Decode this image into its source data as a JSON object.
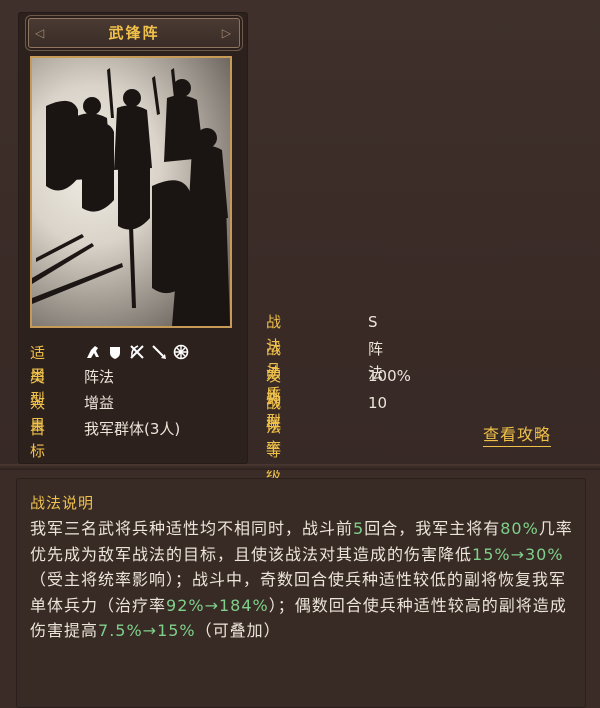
{
  "card": {
    "name": "武锋阵",
    "title_ornament_left": "◁",
    "title_ornament_right": "▷"
  },
  "properties": {
    "applicable_label": "适用",
    "troop_type_icons": [
      "cavalry-icon",
      "shield-icon",
      "bow-icon",
      "spear-icon",
      "siege-icon"
    ],
    "type_label": "类型",
    "type_value": "阵法",
    "effect_label": "效果",
    "effect_value": "增益",
    "target_label": "目标",
    "target_value": "我军群体(3人)"
  },
  "stats": [
    {
      "label": "战法品质",
      "value": "S"
    },
    {
      "label": "战法类型",
      "value": "阵法"
    },
    {
      "label": "发动概率",
      "value": "100%"
    },
    {
      "label": "战法等级",
      "value": "10"
    }
  ],
  "guide_link": "查看攻略",
  "description": {
    "title": "战法说明",
    "segments": [
      {
        "text": "我军三名武将兵种适性均不相同时，战斗前",
        "hl": false
      },
      {
        "text": "5",
        "hl": true
      },
      {
        "text": "回合，我军主将有",
        "hl": false
      },
      {
        "text": "80%",
        "hl": true
      },
      {
        "text": "几率优先成为敌军战法的目标，且使该战法对其造成的伤害降低",
        "hl": false
      },
      {
        "text": "15%→30%",
        "hl": true
      },
      {
        "text": "（受主将统率影响）；战斗中，奇数回合使兵种适性较低的副将恢复我军单体兵力（治疗率",
        "hl": false
      },
      {
        "text": "92%→184%",
        "hl": true
      },
      {
        "text": "）；偶数回合使兵种适性较高的副将造成伤害提高",
        "hl": false
      },
      {
        "text": "7.5%→15%",
        "hl": true
      },
      {
        "text": "（可叠加）",
        "hl": false
      }
    ]
  },
  "colors": {
    "gold": "#f0c14a",
    "highlight_green": "#7fd08a",
    "text": "#ece5da",
    "background": "#3b2c28"
  }
}
